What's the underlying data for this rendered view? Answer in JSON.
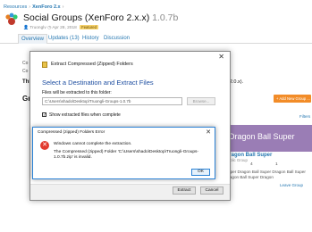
{
  "breadcrumb": {
    "root": "Resources",
    "sep": "›",
    "category": "XenForo 2.x",
    "end": "›"
  },
  "resource": {
    "title": "Social Groups (XenForo 2.x.x)",
    "version": "1.0.7b",
    "author": "Truonglv",
    "date": "Apr 28, 2018",
    "badge": "Featured"
  },
  "tabs": [
    {
      "label": "Overview"
    },
    {
      "label": "Updates (13)"
    },
    {
      "label": "History"
    },
    {
      "label": "Discussion"
    }
  ],
  "background": {
    "left_cut_1": "Co",
    "left_cut_2": "Co",
    "left_cut_3": "Thi",
    "left_cut_g": "Gr",
    "right_note": "(2.0.x).",
    "add_group_button": "+ Add New Group ...",
    "filters": "Filters",
    "banner_text": "Dragon Ball Super",
    "group_name": "Dragon Ball Super",
    "group_sub": "Public Group",
    "stats": [
      "5",
      "4",
      "1"
    ],
    "group_desc": "Super Dragon Ball Super Dragon Ball Super Dragon Ball Super Dragon",
    "leave_group": "Leave Group"
  },
  "extract_dialog": {
    "title": "Extract Compressed (Zipped) Folders",
    "heading": "Select a Destination and Extract Files",
    "files_label": "Files will be extracted to this folder:",
    "path_value": "C:\\Users\\shado\\Desktop\\Truongli-Groups-1.0.7b",
    "browse_label": "Browse...",
    "checkbox_checked": true,
    "checkbox_label": "Show extracted files when complete",
    "extract_label": "Extract",
    "cancel_label": "Cancel",
    "close_label": "✕"
  },
  "error_dialog": {
    "title": "Compressed (zipped) Folders Error",
    "close_label": "✕",
    "message": "Windows cannot complete the extraction.",
    "detail": "The Compressed (zipped) Folder 'C:\\Users\\shado\\Desktop\\Truongli-Groups-1.0.7b.zip' is invalid.",
    "ok_label": "OK",
    "icon_mark": "✕"
  }
}
